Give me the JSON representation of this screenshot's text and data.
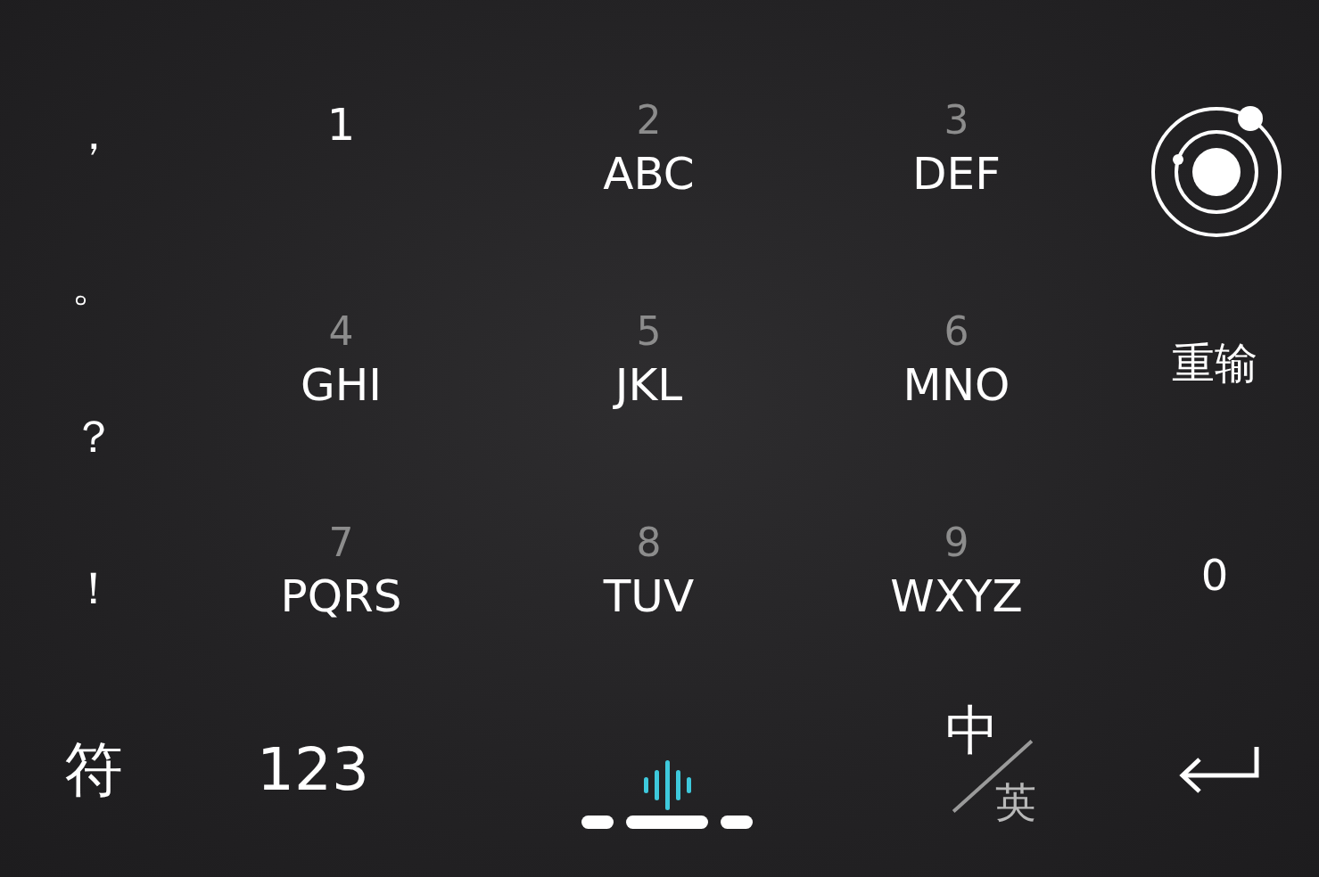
{
  "punctuation": [
    "，",
    "。",
    "？",
    "！"
  ],
  "keys": [
    {
      "digit": "1"
    },
    {
      "digit": "2",
      "letters": "ABC"
    },
    {
      "digit": "3",
      "letters": "DEF"
    },
    {
      "digit": "4",
      "letters": "GHI"
    },
    {
      "digit": "5",
      "letters": "JKL"
    },
    {
      "digit": "6",
      "letters": "MNO"
    },
    {
      "digit": "7",
      "letters": "PQRS"
    },
    {
      "digit": "8",
      "letters": "TUV"
    },
    {
      "digit": "9",
      "letters": "WXYZ"
    }
  ],
  "side_keys": [
    {
      "kind": "logo"
    },
    {
      "kind": "text",
      "label": "重输"
    },
    {
      "kind": "text",
      "label": "0"
    }
  ],
  "bottom_row": [
    {
      "kind": "text",
      "label": "符"
    },
    {
      "kind": "text",
      "label": "123"
    },
    {
      "kind": "voice"
    },
    {
      "kind": "lang",
      "primary": "中",
      "secondary": "英"
    },
    {
      "kind": "enter"
    }
  ]
}
